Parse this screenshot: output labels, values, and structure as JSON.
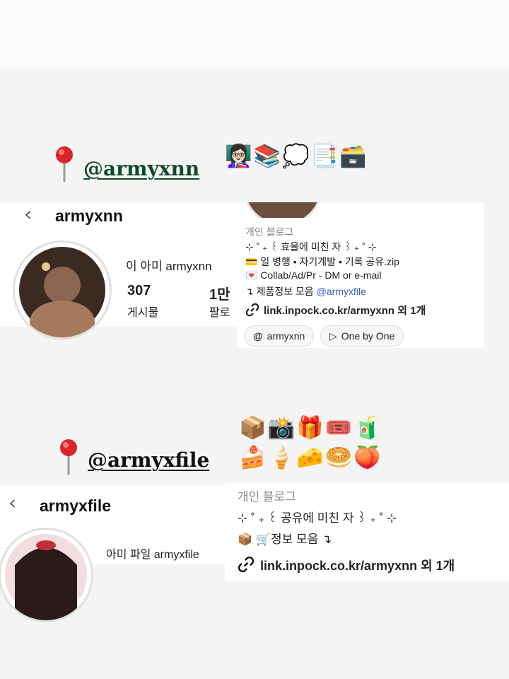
{
  "section1": {
    "handle": "@armyxnn",
    "emojis": "👩🏻‍🏫📚💭📑🗃️",
    "profile": {
      "username": "armyxnn",
      "display_name": "이 아미 armyxnn",
      "posts_count": "307",
      "posts_label": "게시물",
      "followers_count": "1만",
      "followers_label": "팔로"
    },
    "bio": {
      "category": "개인 블로그",
      "line1": "⊹ ˚ ₊ ꒰ 효율에 미친 자 ꒱ ₊ ˚ ⊹",
      "line2": "💳 일 병행 • 자기계발 • 기록 공유.zip",
      "line3": "💌 Collab/Ad/Pr - DM or e-mail",
      "line4_prefix": "↴ 제품정보 모음 ",
      "line4_link": "@armyxfile",
      "link": "link.inpock.co.kr/armyxnn 외 1개",
      "pills": [
        "armyxnn",
        "One by One"
      ]
    }
  },
  "section2": {
    "handle": "@armyxfile",
    "emojis_row1": "📦📸🎁🎟️🧃",
    "emojis_row2": "🍰🍦🧀🥯🍑",
    "profile": {
      "username": "armyxfile",
      "display_name": "아미 파일 armyxfile"
    },
    "bio": {
      "category": "개인 블로그",
      "line1": "⊹ ˚ ₊ ꒰ 공유에 미친 자 ꒱ ₊ ˚ ⊹",
      "line2": "📦 🛒정보 모음 ↴",
      "link": "link.inpock.co.kr/armyxnn 외 1개"
    }
  },
  "colors": {
    "handle_green": "#0f4b2a",
    "link_blue": "#3b5bb7"
  }
}
